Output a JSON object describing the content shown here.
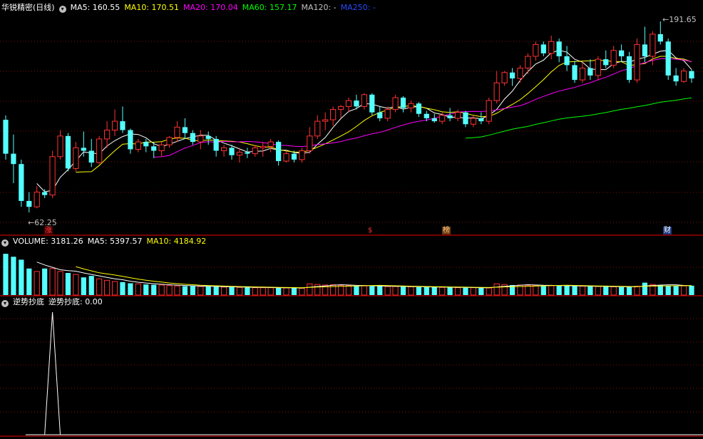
{
  "price_panel": {
    "title": "华锐精密(日线)",
    "indicators": [
      {
        "label": "MA5: 160.55",
        "color": "#ffffff"
      },
      {
        "label": "MA10: 170.51",
        "color": "#ffff00"
      },
      {
        "label": "MA20: 170.04",
        "color": "#ff00ff"
      },
      {
        "label": "MA60: 157.17",
        "color": "#00ff00"
      },
      {
        "label": "MA120: -",
        "color": "#c0c0c0"
      },
      {
        "label": "MA250: -",
        "color": "#2a4bff"
      }
    ],
    "high_label": "191.65",
    "low_label": "62.25",
    "event_markers": [
      {
        "text": "涨",
        "color": "#ff4040",
        "bg": "#4a0000"
      },
      {
        "text": "$",
        "color": "#ff3030",
        "bg": "#000000"
      },
      {
        "text": "榜",
        "color": "#ffcc88",
        "bg": "#6a3a10"
      },
      {
        "text": "财",
        "color": "#ffffff",
        "bg": "#1c3a80"
      }
    ]
  },
  "volume_panel": {
    "indicators": [
      {
        "label": "VOLUME: 3181.26",
        "color": "#ffffff"
      },
      {
        "label": "MA5: 5397.57",
        "color": "#ffffff"
      },
      {
        "label": "MA10: 4184.92",
        "color": "#ffff00"
      }
    ]
  },
  "signal_panel": {
    "indicators": [
      {
        "label": "逆势抄底",
        "color": "#ffffff"
      },
      {
        "label": "逆势抄底: 0.00",
        "color": "#ffffff"
      }
    ]
  },
  "chart_data": {
    "type": "candlestick",
    "title": "华锐精密(日线)",
    "price_range": [
      62.25,
      191.65
    ],
    "up_color": "#ff3232",
    "down_color": "#54ffff",
    "candles": [
      [
        125,
        128,
        98,
        102
      ],
      [
        102,
        115,
        82,
        95
      ],
      [
        95,
        98,
        66,
        70
      ],
      [
        70,
        76,
        62.25,
        66
      ],
      [
        66,
        80,
        65,
        76
      ],
      [
        76,
        78,
        72,
        74
      ],
      [
        74,
        104,
        72,
        100
      ],
      [
        100,
        118,
        98,
        114
      ],
      [
        114,
        116,
        90,
        92
      ],
      [
        92,
        110,
        90,
        106
      ],
      [
        106,
        117,
        100,
        104
      ],
      [
        104,
        112,
        93,
        96
      ],
      [
        96,
        114,
        95,
        112
      ],
      [
        112,
        124,
        106,
        118
      ],
      [
        118,
        132,
        114,
        124
      ],
      [
        124,
        134,
        116,
        118
      ],
      [
        118,
        119,
        102,
        105
      ],
      [
        105,
        112,
        103,
        110
      ],
      [
        110,
        112,
        103,
        107
      ],
      [
        107,
        110,
        99,
        104
      ],
      [
        104,
        110,
        100,
        108
      ],
      [
        108,
        114,
        106,
        113
      ],
      [
        113,
        124,
        110,
        120
      ],
      [
        120,
        126,
        112,
        116
      ],
      [
        116,
        118,
        108,
        110
      ],
      [
        110,
        118,
        105,
        114
      ],
      [
        114,
        117,
        108,
        112
      ],
      [
        112,
        114,
        100,
        104
      ],
      [
        104,
        108,
        100,
        106
      ],
      [
        106,
        108,
        98,
        101
      ],
      [
        101,
        106,
        96,
        103
      ],
      [
        103,
        106,
        99,
        102
      ],
      [
        102,
        108,
        100,
        106
      ],
      [
        106,
        110,
        100,
        107
      ],
      [
        107,
        112,
        103,
        110
      ],
      [
        110,
        111,
        94,
        97
      ],
      [
        97,
        104,
        96,
        102
      ],
      [
        102,
        104,
        96,
        98
      ],
      [
        98,
        106,
        96,
        104
      ],
      [
        104,
        120,
        102,
        114
      ],
      [
        114,
        128,
        112,
        124
      ],
      [
        124,
        130,
        118,
        125
      ],
      [
        125,
        134,
        121,
        132
      ],
      [
        132,
        135,
        126,
        134
      ],
      [
        134,
        140,
        130,
        138
      ],
      [
        138,
        142,
        132,
        134
      ],
      [
        134,
        143,
        132,
        142
      ],
      [
        142,
        143,
        128,
        130
      ],
      [
        130,
        134,
        124,
        126
      ],
      [
        126,
        134,
        124,
        132
      ],
      [
        132,
        142,
        130,
        140
      ],
      [
        140,
        141,
        130,
        133
      ],
      [
        133,
        138,
        130,
        136
      ],
      [
        136,
        137,
        127,
        129
      ],
      [
        129,
        131,
        124,
        126
      ],
      [
        126,
        129,
        123,
        124
      ],
      [
        124,
        130,
        122,
        128
      ],
      [
        128,
        133,
        124,
        126
      ],
      [
        126,
        132,
        124,
        130
      ],
      [
        130,
        131,
        120,
        122
      ],
      [
        122,
        128,
        120,
        126
      ],
      [
        126,
        130,
        122,
        124
      ],
      [
        124,
        140,
        122,
        138
      ],
      [
        138,
        158,
        136,
        150
      ],
      [
        150,
        158,
        148,
        157
      ],
      [
        157,
        160,
        148,
        153
      ],
      [
        153,
        162,
        150,
        160
      ],
      [
        160,
        170,
        156,
        168
      ],
      [
        168,
        178,
        165,
        176
      ],
      [
        176,
        178,
        168,
        170
      ],
      [
        170,
        182,
        166,
        178
      ],
      [
        178,
        180,
        164,
        168
      ],
      [
        168,
        175,
        158,
        162
      ],
      [
        162,
        165,
        150,
        152
      ],
      [
        152,
        164,
        150,
        160
      ],
      [
        160,
        166,
        152,
        155
      ],
      [
        155,
        168,
        152,
        166
      ],
      [
        166,
        172,
        160,
        162
      ],
      [
        162,
        175,
        160,
        172
      ],
      [
        172,
        176,
        164,
        168
      ],
      [
        168,
        171,
        150,
        152
      ],
      [
        152,
        180,
        150,
        176
      ],
      [
        176,
        188,
        164,
        168
      ],
      [
        168,
        185,
        162,
        183
      ],
      [
        183,
        191.65,
        176,
        178
      ],
      [
        178,
        180,
        152,
        155
      ],
      [
        155,
        160,
        148,
        151
      ],
      [
        151,
        160,
        150,
        158
      ],
      [
        158,
        159,
        150,
        153
      ]
    ],
    "ma_lines": [
      {
        "name": "MA5",
        "color": "#ffffff"
      },
      {
        "name": "MA10",
        "color": "#ffff00"
      },
      {
        "name": "MA20",
        "color": "#ff00ff"
      },
      {
        "name": "MA60",
        "color": "#00ff00"
      }
    ],
    "volume": [
      14000,
      13000,
      12000,
      9000,
      8000,
      9000,
      9000,
      8000,
      7500,
      7000,
      6000,
      6500,
      5500,
      5000,
      4600,
      4400,
      4000,
      3800,
      3600,
      3500,
      3400,
      3200,
      3100,
      3000,
      3000,
      2900,
      2900,
      2800,
      2700,
      2700,
      2600,
      2600,
      2500,
      2500,
      2500,
      2400,
      2400,
      2400,
      2300,
      3800,
      3600,
      3400,
      3500,
      3300,
      3200,
      3100,
      3100,
      3000,
      3000,
      2900,
      2900,
      2800,
      2800,
      2700,
      2700,
      2700,
      2600,
      2600,
      2500,
      2500,
      2500,
      2400,
      2400,
      3800,
      3600,
      3400,
      3400,
      3300,
      3300,
      3200,
      3200,
      3100,
      3100,
      3000,
      3000,
      2900,
      2900,
      2800,
      2800,
      2700,
      2700,
      3000,
      4200,
      3600,
      3400,
      3200,
      3000,
      3100,
      3181.26
    ],
    "volume_max": 15000,
    "signal": {
      "index": 6,
      "peak": 1.0,
      "last_value": 0.0
    }
  }
}
